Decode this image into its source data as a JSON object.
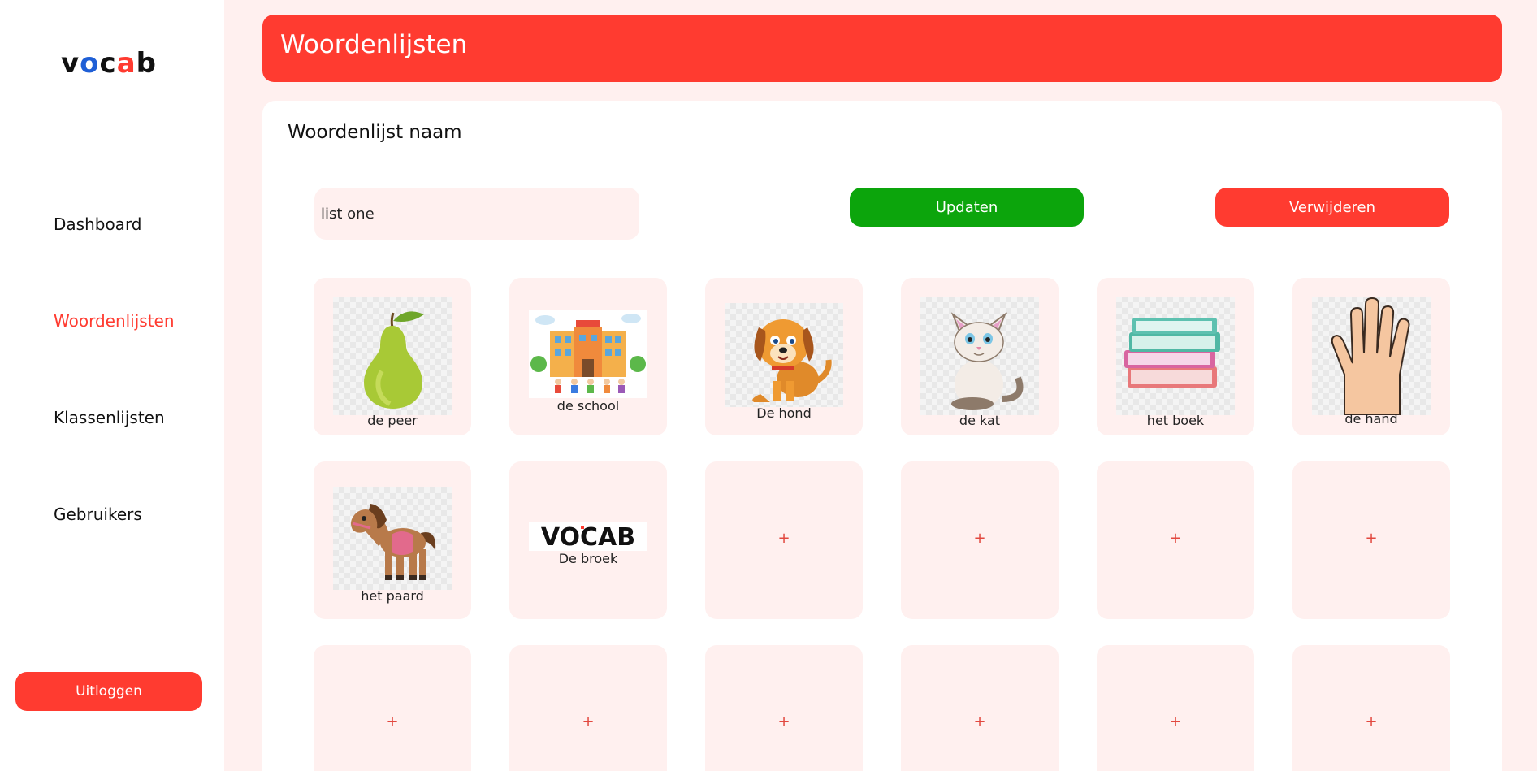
{
  "app": {
    "logo": {
      "v": "v",
      "o": "o",
      "c": "c",
      "a": "a",
      "b": "b"
    }
  },
  "sidebar": {
    "items": [
      {
        "label": "Dashboard",
        "active": false
      },
      {
        "label": "Woordenlijsten",
        "active": true
      },
      {
        "label": "Klassenlijsten",
        "active": false
      },
      {
        "label": "Gebruikers",
        "active": false
      }
    ],
    "logout_label": "Uitloggen"
  },
  "header": {
    "title": "Woordenlijsten"
  },
  "form": {
    "title": "Woordenlijst naam",
    "name_value": "list one",
    "update_label": "Updaten",
    "delete_label": "Verwijderen"
  },
  "words": [
    {
      "label": "de peer",
      "icon": "pear-image"
    },
    {
      "label": "de school",
      "icon": "school-image"
    },
    {
      "label": "De hond",
      "icon": "dog-image"
    },
    {
      "label": "de kat",
      "icon": "cat-image"
    },
    {
      "label": "het boek",
      "icon": "books-image"
    },
    {
      "label": "de hand",
      "icon": "hand-image"
    },
    {
      "label": "het paard",
      "icon": "horse-image"
    },
    {
      "label": "De broek",
      "icon": "vocab-logo-image",
      "image_text": "VOCAB"
    }
  ],
  "add_tile_symbol": "+",
  "colors": {
    "accent": "#ff3b30",
    "success": "#0ca50c",
    "tile_bg": "#fff0ef",
    "logo_o": "#1f5fd6"
  }
}
